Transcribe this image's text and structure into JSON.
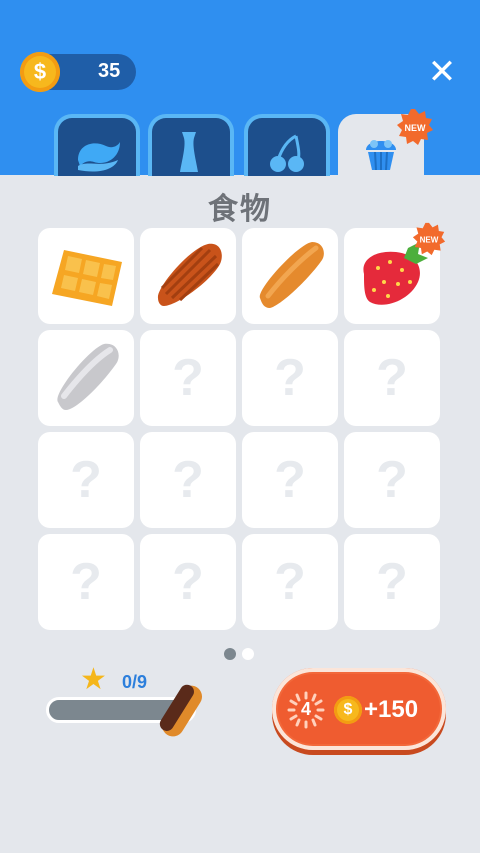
{
  "header": {
    "coins": "35",
    "coin_symbol": "$",
    "close_label": "✕"
  },
  "tabs": [
    {
      "icon": "wave-icon",
      "active": false
    },
    {
      "icon": "vase-icon",
      "active": false
    },
    {
      "icon": "cherry-icon",
      "active": false
    },
    {
      "icon": "cupcake-icon",
      "active": true,
      "badge": "NEW"
    }
  ],
  "category_title": "食物",
  "grid": {
    "items": [
      {
        "icon": "waffle-icon",
        "unlocked": true
      },
      {
        "icon": "cupcake-liner-icon",
        "unlocked": true
      },
      {
        "icon": "bread-loaf-icon",
        "unlocked": true
      },
      {
        "icon": "strawberry-icon",
        "unlocked": true,
        "badge": "NEW"
      },
      {
        "icon": "hotdog-bun-icon",
        "unlocked": true
      },
      {
        "icon": "unknown-item-icon",
        "label": "?",
        "unlocked": false
      },
      {
        "icon": "unknown-item-icon",
        "label": "?",
        "unlocked": false
      },
      {
        "icon": "unknown-item-icon",
        "label": "?",
        "unlocked": false
      },
      {
        "icon": "unknown-item-icon",
        "label": "?",
        "unlocked": false
      },
      {
        "icon": "unknown-item-icon",
        "label": "?",
        "unlocked": false
      },
      {
        "icon": "unknown-item-icon",
        "label": "?",
        "unlocked": false
      },
      {
        "icon": "unknown-item-icon",
        "label": "?",
        "unlocked": false
      },
      {
        "icon": "unknown-item-icon",
        "label": "?",
        "unlocked": false
      },
      {
        "icon": "unknown-item-icon",
        "label": "?",
        "unlocked": false
      },
      {
        "icon": "unknown-item-icon",
        "label": "?",
        "unlocked": false
      },
      {
        "icon": "unknown-item-icon",
        "label": "?",
        "unlocked": false
      }
    ]
  },
  "pagination": {
    "pages": 2,
    "current": 1
  },
  "progress": {
    "text": "0/9",
    "value": 0,
    "max": 9,
    "reward_item_icon": "eclair-icon"
  },
  "reward_button": {
    "timer": "4",
    "coin_symbol": "$",
    "amount": "+150"
  },
  "colors": {
    "header_blue": "#2f8ff0",
    "tab_dark": "#1d4f8c",
    "accent_orange": "#f2683a",
    "coin_gold": "#f7b81d",
    "new_badge": "#f26a2c",
    "progress_blue": "#2c7fdc"
  }
}
